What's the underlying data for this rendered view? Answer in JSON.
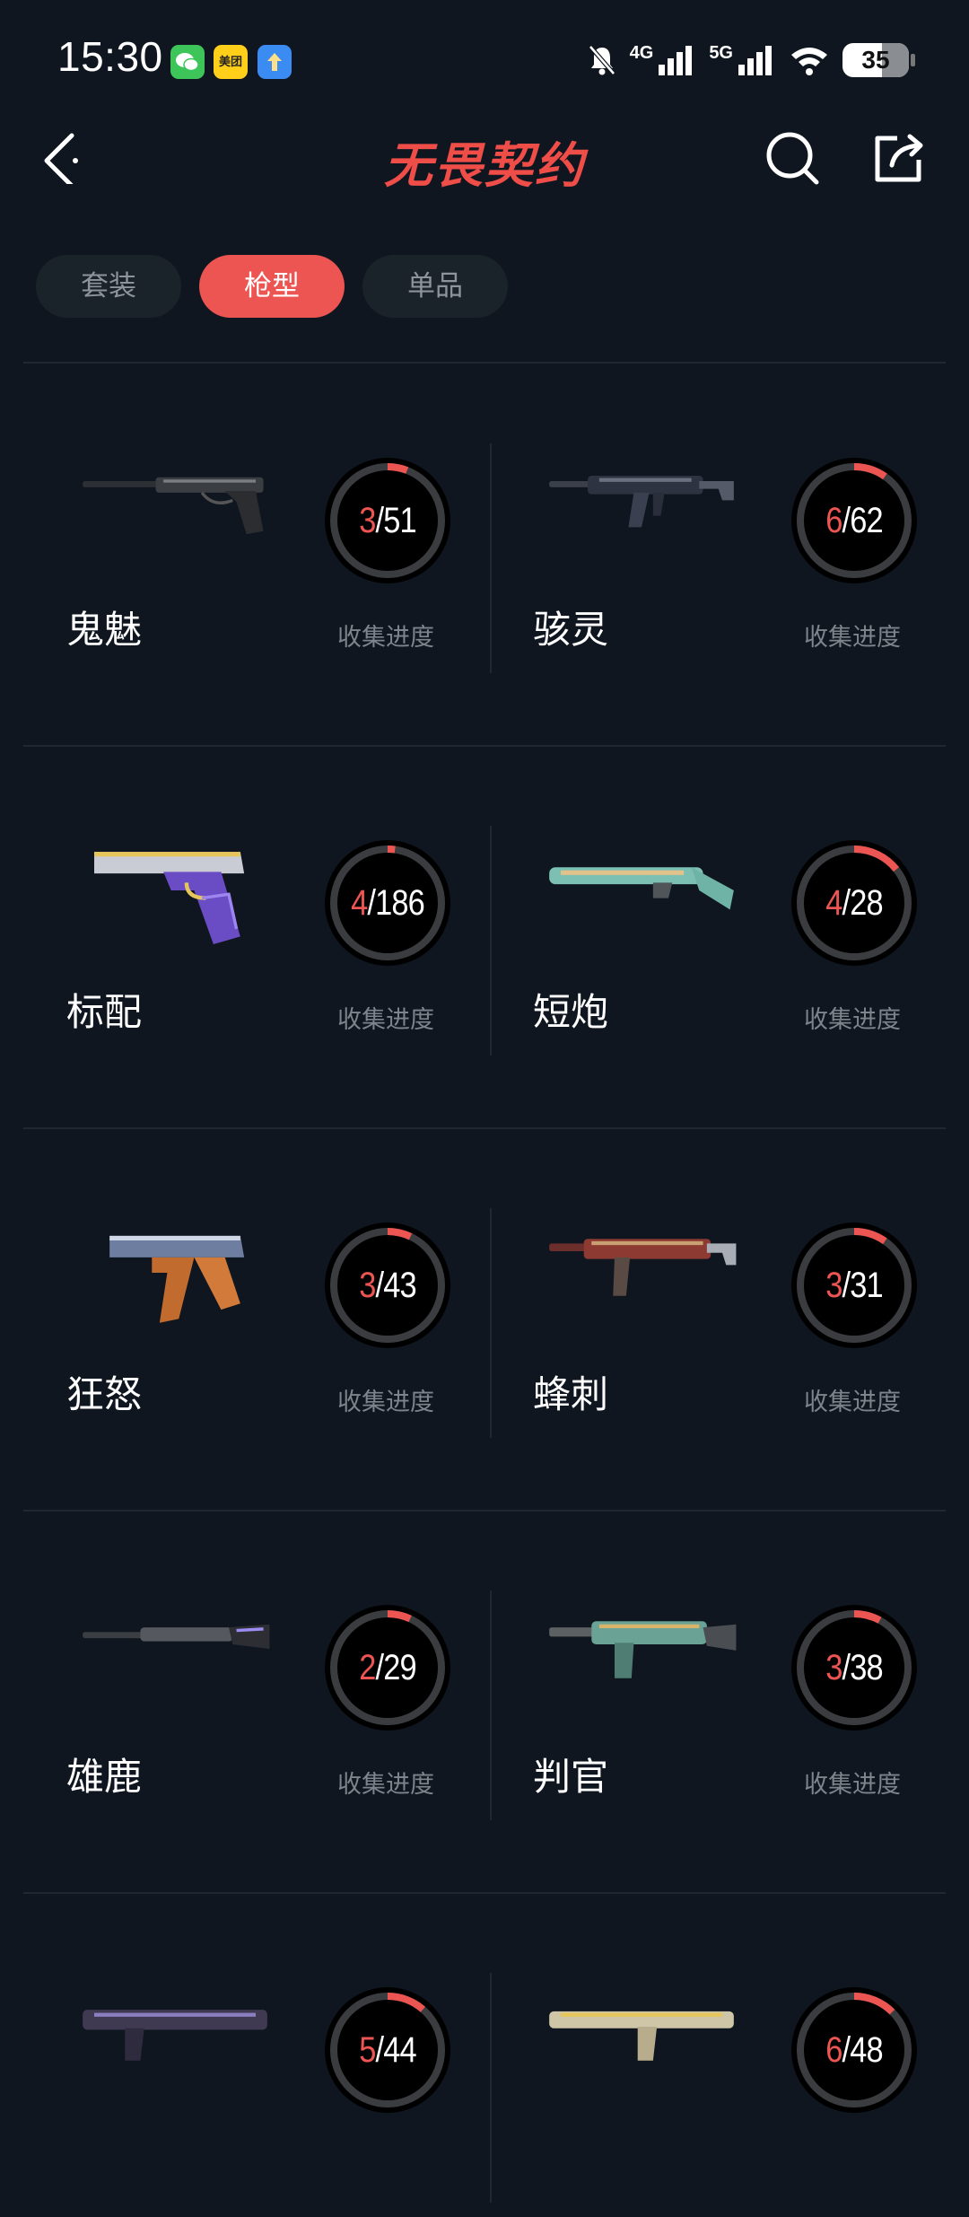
{
  "status_bar": {
    "time": "15:30",
    "apps": [
      {
        "icon": "wechat-icon",
        "color": "#3ec55a",
        "label": ""
      },
      {
        "icon": "meituan-icon",
        "color": "#ffcf1a",
        "label": "美团"
      },
      {
        "icon": "upload-app-icon",
        "color": "#3b8cf2",
        "label": ""
      }
    ],
    "net_4g": "4G",
    "net_5g": "5G",
    "battery": "35"
  },
  "nav": {
    "logo": "无畏契约"
  },
  "tabs": [
    {
      "label": "套装",
      "active": false
    },
    {
      "label": "枪型",
      "active": true
    },
    {
      "label": "单品",
      "active": false
    }
  ],
  "colors": {
    "accent": "#ec5552",
    "background": "#0f1620",
    "ring_track": "#3a3c3f"
  },
  "progress_label": "收集进度",
  "weapons": [
    {
      "name": "鬼魅",
      "owned": 3,
      "total": 51,
      "gun": "pistol-silenced",
      "fraction": 0.059
    },
    {
      "name": "骇灵",
      "owned": 6,
      "total": 62,
      "gun": "smg",
      "fraction": 0.097
    },
    {
      "name": "标配",
      "owned": 4,
      "total": 186,
      "gun": "pistol-gold",
      "fraction": 0.022
    },
    {
      "name": "短炮",
      "owned": 4,
      "total": 28,
      "gun": "shotgun-teal",
      "fraction": 0.143
    },
    {
      "name": "狂怒",
      "owned": 3,
      "total": 43,
      "gun": "pistol-bronze",
      "fraction": 0.07
    },
    {
      "name": "蜂刺",
      "owned": 3,
      "total": 31,
      "gun": "smg-red",
      "fraction": 0.097
    },
    {
      "name": "雄鹿",
      "owned": 2,
      "total": 29,
      "gun": "shotgun-dark",
      "fraction": 0.069
    },
    {
      "name": "判官",
      "owned": 3,
      "total": 38,
      "gun": "shotgun-auto",
      "fraction": 0.079
    },
    {
      "name": "",
      "owned": 5,
      "total": 44,
      "gun": "rifle-purple",
      "fraction": 0.114
    },
    {
      "name": "",
      "owned": 6,
      "total": 48,
      "gun": "rifle-gold",
      "fraction": 0.125
    }
  ]
}
